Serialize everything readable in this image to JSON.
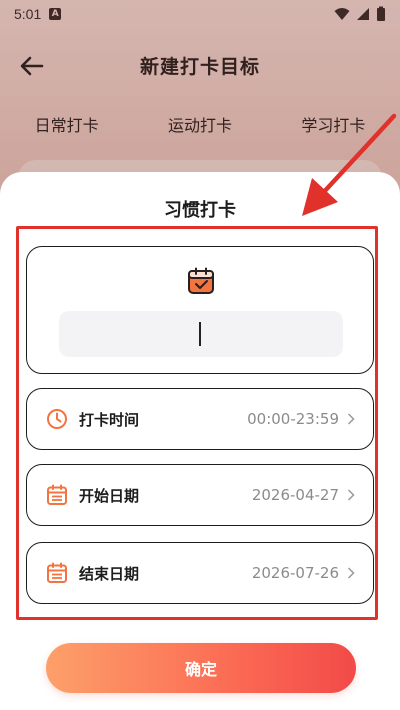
{
  "status_bar": {
    "time": "5:01",
    "sim_label": "A"
  },
  "header": {
    "title": "新建打卡目标"
  },
  "tabs": [
    {
      "label": "日常打卡"
    },
    {
      "label": "运动打卡"
    },
    {
      "label": "学习打卡"
    }
  ],
  "sheet": {
    "title": "习惯打卡",
    "name_input": {
      "value": "",
      "placeholder": ""
    },
    "rows": {
      "time": {
        "label": "打卡时间",
        "value": "00:00-23:59"
      },
      "start": {
        "label": "开始日期",
        "value": "2026-04-27"
      },
      "end": {
        "label": "结束日期",
        "value": "2026-07-26"
      }
    },
    "confirm_label": "确定"
  },
  "colors": {
    "accent": "#fb6b54",
    "icon_orange": "#f3743f",
    "annotation_red": "#e0312b"
  }
}
